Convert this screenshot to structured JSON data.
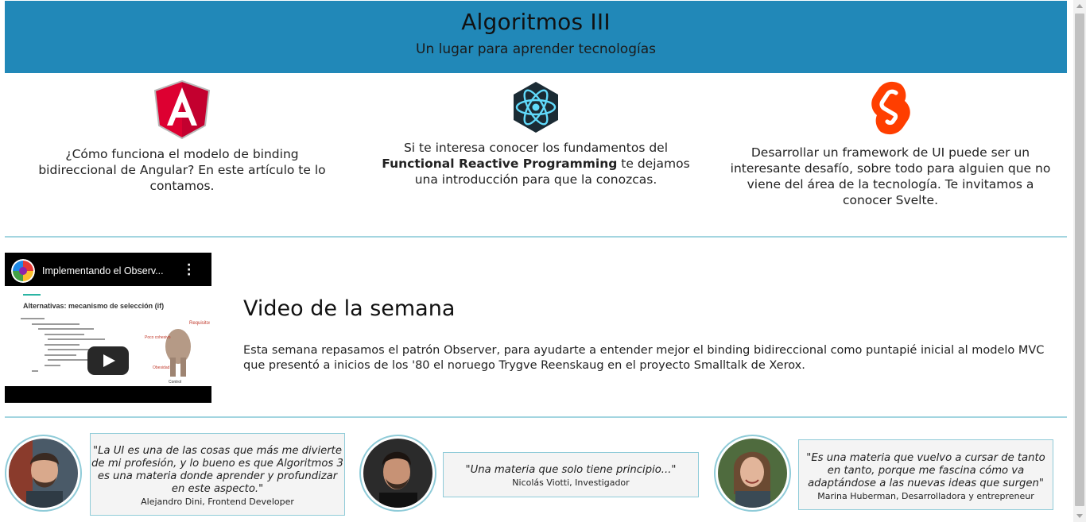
{
  "header": {
    "title": "Algoritmos III",
    "subtitle": "Un lugar para aprender tecnologías"
  },
  "features": [
    {
      "icon": "angular-logo-icon",
      "text": "¿Cómo funciona el modelo de binding bidireccional de Angular? En este artículo te lo contamos."
    },
    {
      "icon": "react-logo-icon",
      "text_before": "Si te interesa conocer los fundamentos del ",
      "text_bold": "Functional Reactive Programming",
      "text_after": " te dejamos una introducción para que la conozcas."
    },
    {
      "icon": "svelte-logo-icon",
      "text": "Desarrollar un framework de UI puede ser un interesante desafío, sobre todo para alguien que no viene del área de la tecnología. Te invitamos a conocer Svelte."
    }
  ],
  "video": {
    "embed_title": "Implementando el Observ...",
    "slide_title": "Alternativas: mecanismo de selección (if)",
    "heading": "Video de la semana",
    "description": "Esta semana repasamos el patrón Observer, para ayudarte a entender mejor el binding bidireccional como puntapié inicial al modelo MVC que presentó a inicios de los '80 el noruego Trygve Reenskaug en el proyecto Smalltalk de Xerox."
  },
  "testimonials": [
    {
      "quote": "\"La UI es una de las cosas que más me divierte de mi profesión, y lo bueno es que Algoritmos 3 es una materia donde aprender y profundizar en este aspecto.\"",
      "author": "Alejandro Dini, Frontend Developer"
    },
    {
      "quote": "\"Una materia que solo tiene principio...\"",
      "author": "Nicolás Viotti, Investigador"
    },
    {
      "quote": "\"Es una materia que vuelvo a cursar de tanto en tanto, porque me fascina cómo va adaptándose a las nuevas ideas que surgen\"",
      "author": "Marina Huberman, Desarrolladora y entrepreneur"
    }
  ],
  "colors": {
    "header_bg": "#2188b8",
    "divider": "#a3d5e0",
    "angular_red": "#dd0031",
    "react_cyan": "#61dafb",
    "svelte_orange": "#ff3e00"
  }
}
